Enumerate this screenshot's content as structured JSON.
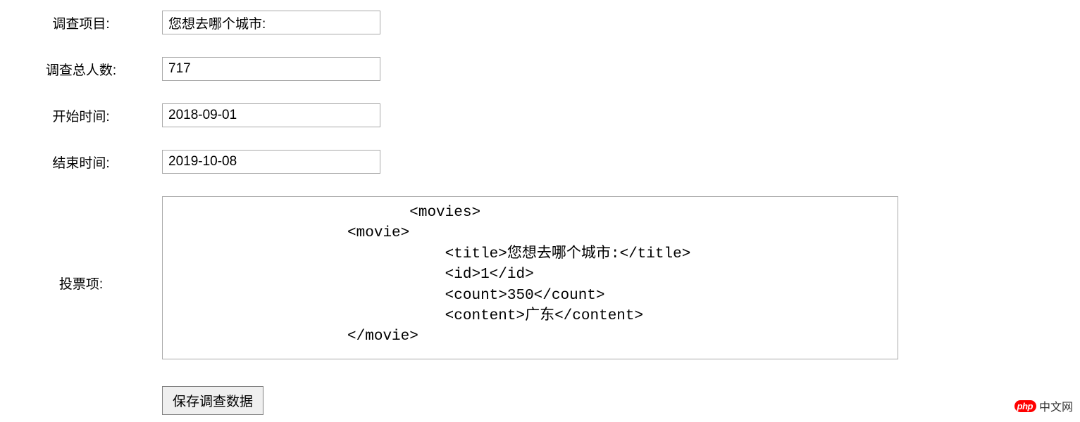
{
  "form": {
    "project": {
      "label": "调查项目:",
      "value": "您想去哪个城市:"
    },
    "total": {
      "label": "调查总人数:",
      "value": "717"
    },
    "start": {
      "label": "开始时间:",
      "value": "2018-09-01"
    },
    "end": {
      "label": "结束时间:",
      "value": "2019-10-08"
    },
    "items": {
      "label": "投票项:",
      "value": "                           <movies>\n                    <movie>\n                               <title>您想去哪个城市:</title>\n                               <id>1</id>\n                               <count>350</count>\n                               <content>广东</content>\n                    </movie>"
    },
    "save_label": "保存调查数据"
  },
  "watermark": {
    "badge": "php",
    "text": "中文网"
  }
}
